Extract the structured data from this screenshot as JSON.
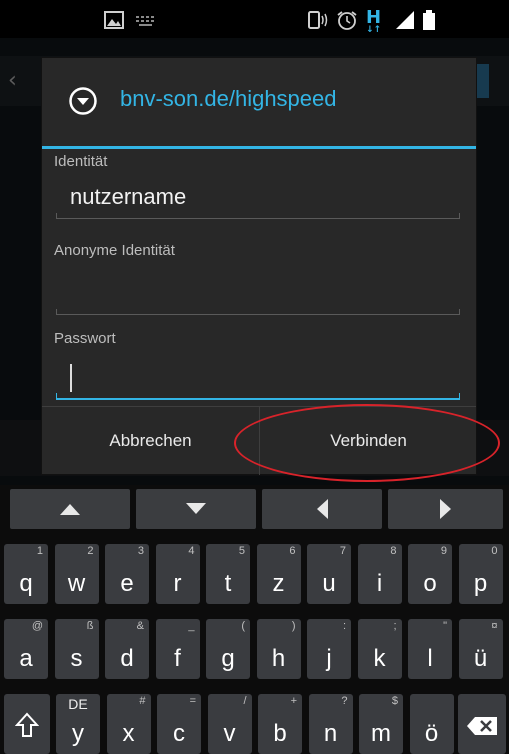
{
  "status_bar": {
    "icons": [
      "gallery-icon",
      "keyboard-icon",
      "vibrate-icon",
      "alarm-icon",
      "hspa-icon",
      "signal-icon",
      "battery-icon"
    ],
    "network_label": "H"
  },
  "dialog": {
    "title": "bnv-son.de/highspeed",
    "accent_color": "#33b5e5",
    "identity_label": "Identität",
    "identity_value": "nutzername",
    "anon_label": "Anonyme Identität",
    "anon_value": "",
    "password_label": "Passwort",
    "password_value": "",
    "cancel_label": "Abbrechen",
    "connect_label": "Verbinden"
  },
  "annotation": {
    "color": "#d8232a"
  },
  "keyboard": {
    "arrows": [
      "arrow-up-icon",
      "arrow-down-icon",
      "arrow-left-icon",
      "arrow-right-icon"
    ],
    "row1": [
      {
        "main": "q",
        "hint": "1"
      },
      {
        "main": "w",
        "hint": "2"
      },
      {
        "main": "e",
        "hint": "3"
      },
      {
        "main": "r",
        "hint": "4"
      },
      {
        "main": "t",
        "hint": "5"
      },
      {
        "main": "z",
        "hint": "6"
      },
      {
        "main": "u",
        "hint": "7"
      },
      {
        "main": "i",
        "hint": "8"
      },
      {
        "main": "o",
        "hint": "9"
      },
      {
        "main": "p",
        "hint": "0"
      }
    ],
    "row2": [
      {
        "main": "a",
        "hint": "@"
      },
      {
        "main": "s",
        "hint": "ß"
      },
      {
        "main": "d",
        "hint": "&"
      },
      {
        "main": "f",
        "hint": "_"
      },
      {
        "main": "g",
        "hint": "("
      },
      {
        "main": "h",
        "hint": ")"
      },
      {
        "main": "j",
        "hint": ":"
      },
      {
        "main": "k",
        "hint": ";"
      },
      {
        "main": "l",
        "hint": "\""
      },
      {
        "main": "ü",
        "hint": "¤"
      }
    ],
    "row3": [
      {
        "main": "y",
        "hint": "!"
      },
      {
        "main": "x",
        "hint": "#"
      },
      {
        "main": "c",
        "hint": "="
      },
      {
        "main": "v",
        "hint": "/"
      },
      {
        "main": "b",
        "hint": "+"
      },
      {
        "main": "n",
        "hint": "?"
      },
      {
        "main": "m",
        "hint": "$"
      },
      {
        "main": "ö",
        "hint": ""
      }
    ],
    "lang_label": "DE"
  }
}
